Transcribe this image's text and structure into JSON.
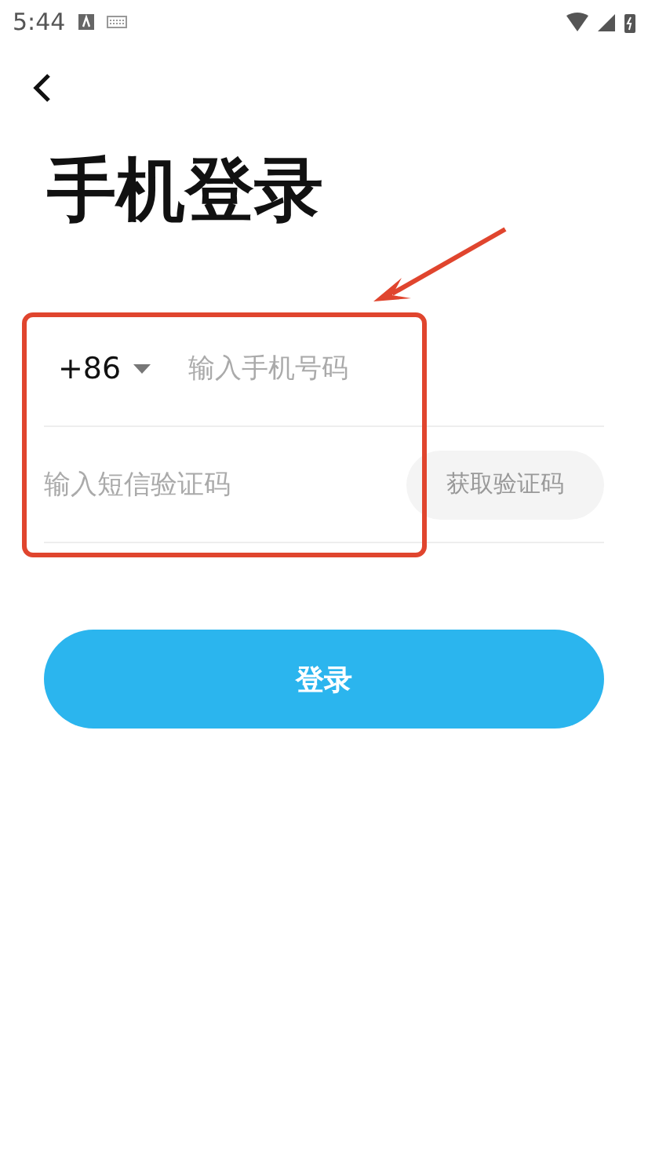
{
  "status_bar": {
    "time": "5:44"
  },
  "title": "手机登录",
  "phone": {
    "country_code": "+86",
    "placeholder": "输入手机号码"
  },
  "code": {
    "placeholder": "输入短信验证码",
    "button": "获取验证码"
  },
  "login_button": "登录",
  "annotation": {
    "kind": "highlight",
    "color": "#e0452e"
  }
}
